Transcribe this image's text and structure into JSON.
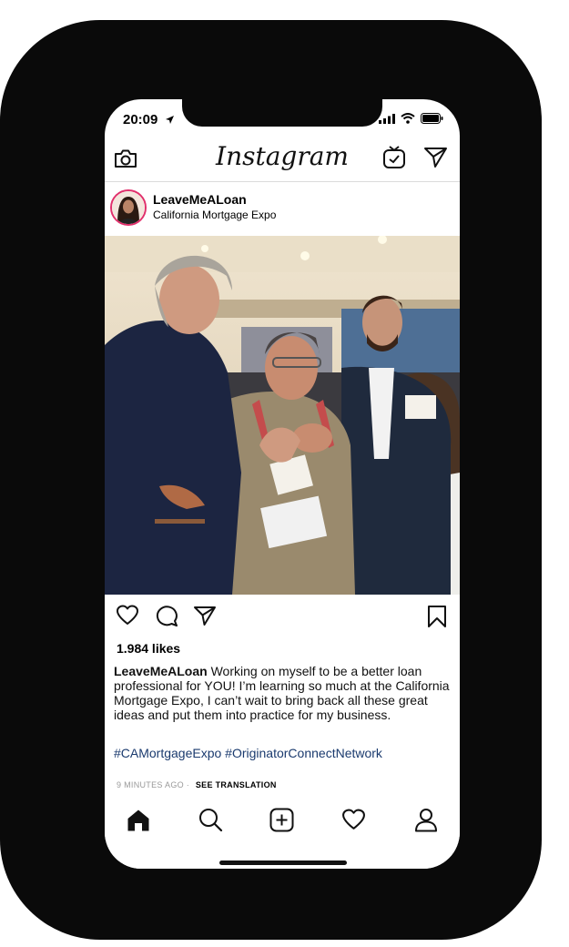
{
  "status_bar": {
    "time": "20:09"
  },
  "app": {
    "brand": "Instagram"
  },
  "post": {
    "username": "LeaveMeALoan",
    "location": "California Mortgage Expo",
    "likes": "1.984 likes",
    "caption_user": "LeaveMeALoan",
    "caption_text": "Working on myself to be a better loan professional for YOU! I’m learning so much at the California Mortgage Expo, I can’t wait to bring back all these great ideas and put them into practice for my business.",
    "hashtags": "#CAMortgageExpo #OriginatorConnectNetwork",
    "time_ago": "9 MINUTES AGO",
    "see_translation": "SEE TRANSLATION"
  },
  "icons": {
    "top_left": "camera-icon",
    "top_right": [
      "igtv-icon",
      "direct-message-icon"
    ],
    "post_actions": [
      "heart-icon",
      "comment-icon",
      "share-icon",
      "bookmark-icon"
    ],
    "bottom_nav": [
      "home-icon",
      "search-icon",
      "add-post-icon",
      "activity-heart-icon",
      "profile-icon"
    ]
  },
  "colors": {
    "hashtag": "#1a3a6e",
    "avatar_ring": "#e1306c",
    "divider": "#dbdbdb"
  }
}
